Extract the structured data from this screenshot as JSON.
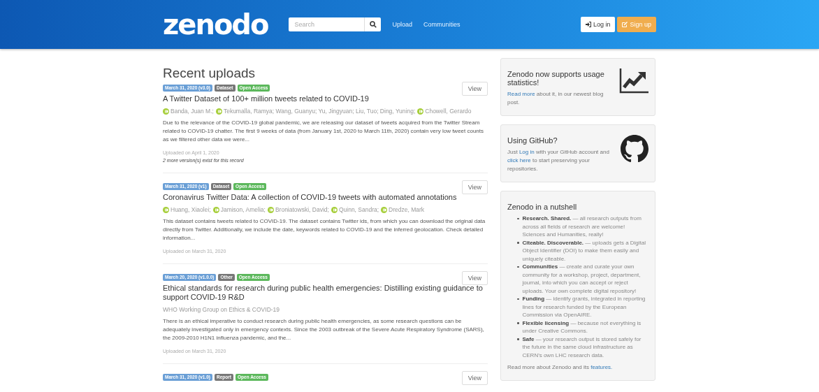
{
  "header": {
    "logo": "zenodo",
    "search": {
      "placeholder": "Search"
    },
    "nav": [
      "Upload",
      "Communities"
    ],
    "login": "Log in",
    "signup": "Sign up"
  },
  "heading": "Recent uploads",
  "records": [
    {
      "badges": [
        {
          "kind": "version",
          "label": "March 31, 2020 (v3.0)"
        },
        {
          "kind": "type",
          "label": "Dataset"
        },
        {
          "kind": "access",
          "label": "Open Access"
        }
      ],
      "view": "View",
      "title": "A Twitter Dataset of 100+ million tweets related to COVID-19",
      "authors": [
        {
          "name": "Banda, Juan M.;",
          "orcid": true
        },
        {
          "name": "Tekumalla, Ramya; Wang, Guanyu; Yu, Jingyuan; Liu, Tuo; Ding, Yuning;",
          "orcid": true
        },
        {
          "name": "Chowell, Gerardo",
          "orcid": true
        }
      ],
      "description": "Due to the relevance of the COVID-19 global pandemic, we are releasing our dataset of tweets acquired from the Twitter Stream related to COVID-19 chatter. The first 9 weeks of data (from January 1st, 2020 to March 11th, 2020) contain very low tweet counts as we filtered other data we were...",
      "uploaded": "Uploaded on April 1, 2020",
      "versions_note": "2 more version(s) exist for this record"
    },
    {
      "badges": [
        {
          "kind": "version",
          "label": "March 31, 2020 (v1)"
        },
        {
          "kind": "type",
          "label": "Dataset"
        },
        {
          "kind": "access",
          "label": "Open Access"
        }
      ],
      "view": "View",
      "title": "Coronavirus Twitter Data: A collection of COVID-19 tweets with automated annotations",
      "authors": [
        {
          "name": "Huang, Xiaolei;",
          "orcid": true
        },
        {
          "name": "Jamison, Amelia;",
          "orcid": true
        },
        {
          "name": "Broniatowski, David;",
          "orcid": true
        },
        {
          "name": "Quinn, Sandra;",
          "orcid": true
        },
        {
          "name": "Dredze, Mark",
          "orcid": true
        }
      ],
      "description": "This dataset contains tweets related to COVID-19. The dataset contains Twitter ids, from which you can download the original data directly from Twitter. Additionally, we include the date, keywords related to COVID-19 and the inferred geolocation. Check detailed information...",
      "uploaded": "Uploaded on March 31, 2020"
    },
    {
      "badges": [
        {
          "kind": "version",
          "label": "March 20, 2020 (v1.0.0)"
        },
        {
          "kind": "type",
          "label": "Other"
        },
        {
          "kind": "access",
          "label": "Open Access"
        }
      ],
      "view": "View",
      "title": "Ethical standards for research during public health emergencies: Distilling existing guidance to support COVID-19 R&D",
      "authors": [
        {
          "name": "WHO Working Group on Ethics & COVID-19",
          "orcid": false
        }
      ],
      "description": "There is an ethical imperative to conduct research during public health emergencies, as some research questions can be adequately investigated only in emergency contexts. Since the 2003 outbreak of the Severe Acute Respiratory Syndrome (SARS), the 2009-2010 H1N1 influenza pandemic, and the...",
      "uploaded": "Uploaded on March 31, 2020"
    },
    {
      "badges": [
        {
          "kind": "version",
          "label": "March 31, 2020 (v1.0)"
        },
        {
          "kind": "type",
          "label": "Report"
        },
        {
          "kind": "access",
          "label": "Open Access"
        }
      ],
      "view": "View"
    }
  ],
  "sidebar": [
    {
      "kind": "stats",
      "title": "Zenodo now supports usage statistics!",
      "text": [
        {
          "text": "Read more",
          "link": true
        },
        {
          "text": " about it, in our newest blog post.",
          "link": false
        }
      ]
    },
    {
      "kind": "github",
      "title": "Using GitHub?",
      "text": [
        {
          "text": "Just ",
          "link": false
        },
        {
          "text": "Log in",
          "link": true
        },
        {
          "text": " with your GitHub account and ",
          "link": false
        },
        {
          "text": "click here",
          "link": true
        },
        {
          "text": " to start preserving your repositories.",
          "link": false
        }
      ]
    },
    {
      "kind": "nutshell",
      "title": "Zenodo in a nutshell",
      "items": [
        "**Research. Shared.** — all research outputs from across all fields of research are welcome! Sciences and Humanities, really!",
        "**Citeable. Discoverable.** — uploads gets a Digital Object Identifier (DOI) to make them easily and uniquely citeable.",
        "**Communities** — create and curate your own community for a workshop, project, department, journal, into which you can accept or reject uploads. Your own complete digital repository!",
        "**Funding** — identify grants, integrated in reporting lines for research funded by the European Commission via OpenAIRE.",
        "**Flexible licensing** — because not everything is under Creative Commons.",
        "**Safe** — your research output is stored safely for the future in the same cloud infrastructure as CERN's own LHC research data."
      ],
      "text": [
        {
          "text": "Read more about Zenodo and its ",
          "link": false
        },
        {
          "text": "features.",
          "link": true
        }
      ]
    }
  ]
}
